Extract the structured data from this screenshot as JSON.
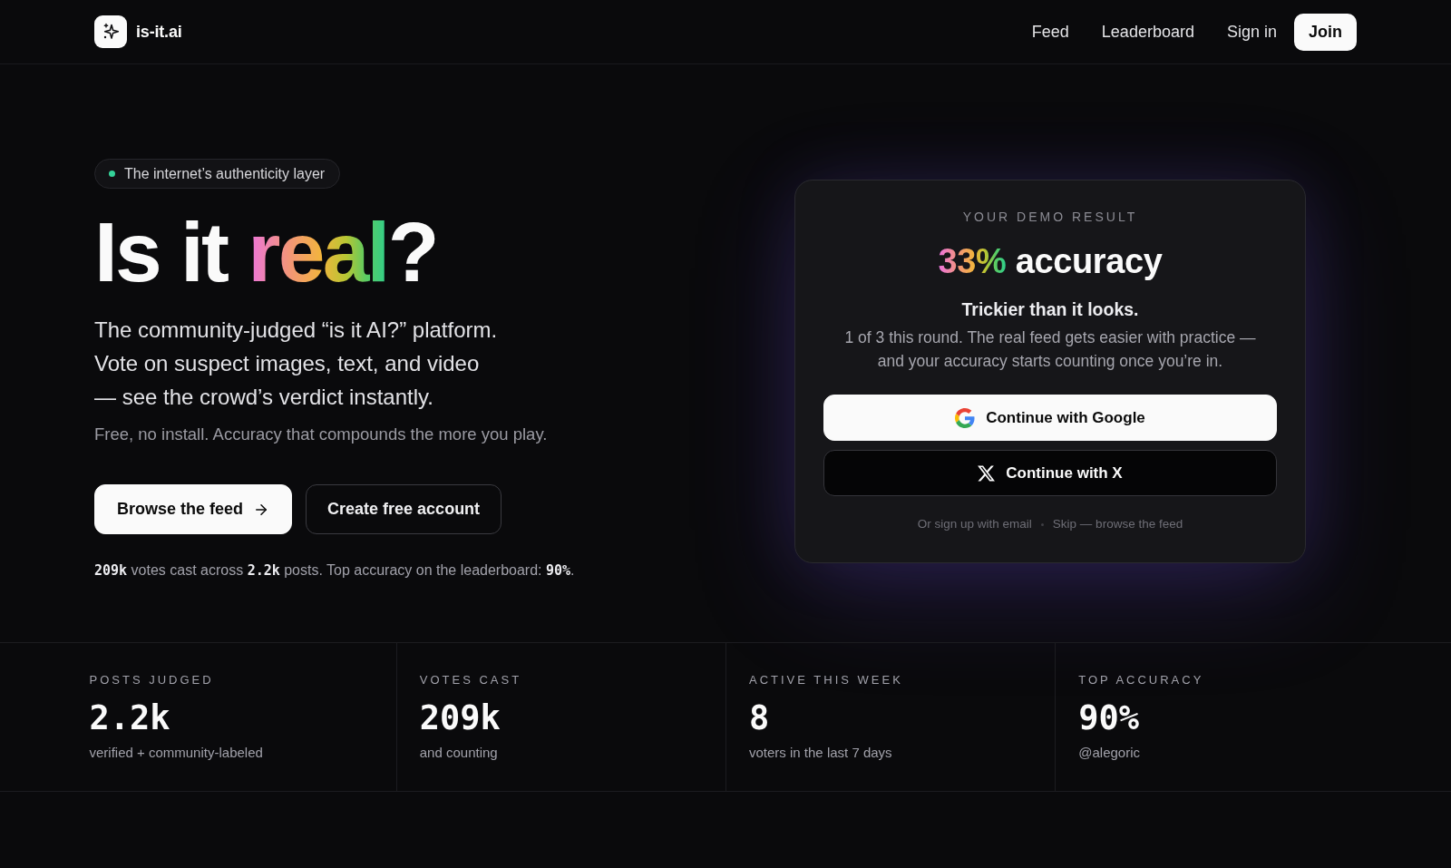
{
  "header": {
    "logo_text": "is-it.ai",
    "nav": [
      {
        "label": "Feed",
        "kind": "link"
      },
      {
        "label": "Leaderboard",
        "kind": "link"
      },
      {
        "label": "Sign in",
        "kind": "link"
      },
      {
        "label": "Join",
        "kind": "button"
      }
    ]
  },
  "hero": {
    "badge": "The internet’s authenticity layer",
    "title": {
      "before": "Is it",
      "highlight": "real",
      "after": "?"
    },
    "description_lines": [
      "The community-judged “is it AI?” platform.",
      "Vote on suspect images, text, and video",
      "— see the crowd’s verdict instantly."
    ],
    "note": "Free, no install. Accuracy that compounds the more you play.",
    "buttons": [
      {
        "label": "Browse the feed",
        "kind": "primary"
      },
      {
        "label": "Create free account",
        "kind": "secondary"
      }
    ],
    "summary": "**209k** votes cast across **2.2k** posts. Top accuracy on the leaderboard: **90%**."
  },
  "demo_card": {
    "eyebrow": "YOUR DEMO RESULT",
    "score": "33%",
    "score_label": "accuracy",
    "headline": "Trickier than it looks.",
    "message_lines": [
      "1 of 3 this round. The real feed gets easier with practice —",
      "and your accuracy starts counting once you’re in."
    ],
    "buttons": [
      {
        "label": "Continue with Google",
        "kind": "google"
      },
      {
        "label": "Continue with X",
        "kind": "x"
      }
    ],
    "links": [
      "Or sign up with email",
      "Skip — browse the feed"
    ]
  },
  "stats": [
    {
      "label": "POSTS JUDGED",
      "value": "2.2k",
      "caption": "verified + community-labeled"
    },
    {
      "label": "VOTES CAST",
      "value": "209k",
      "caption": "and counting"
    },
    {
      "label": "ACTIVE THIS WEEK",
      "value": "8",
      "caption": "voters in the last 7 days"
    },
    {
      "label": "TOP ACCURACY",
      "value": "90%",
      "caption": "@alegoric"
    }
  ]
}
